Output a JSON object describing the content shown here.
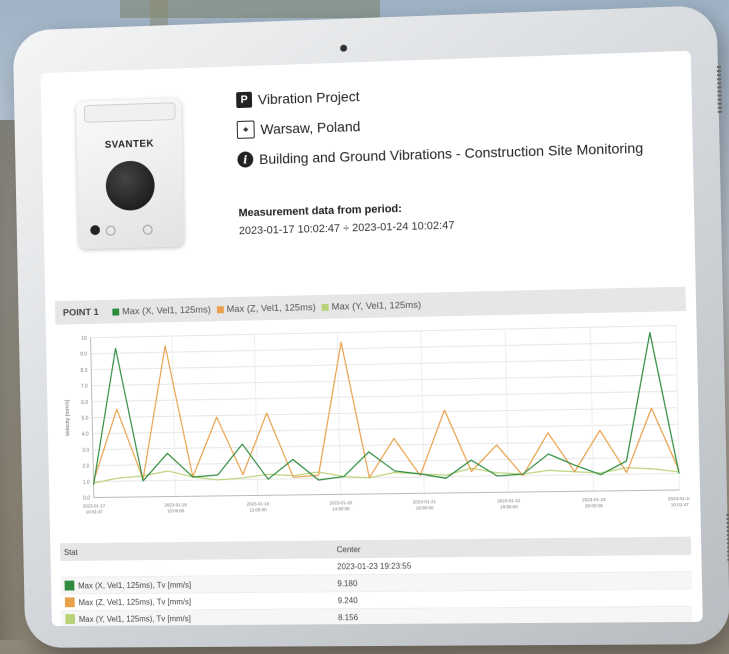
{
  "project": {
    "name": "Vibration Project",
    "location": "Warsaw, Poland",
    "description": "Building and Ground Vibrations - Construction Site Monitoring",
    "device_brand": "SVANTEK"
  },
  "period": {
    "label": "Measurement data from period:",
    "value": "2023-01-17 10:02:47 ÷ 2023-01-24 10:02:47"
  },
  "legend": {
    "point": "POINT 1",
    "items": [
      {
        "label": "Max (X, Vel1, 125ms)",
        "color": "#2e8b3e"
      },
      {
        "label": "Max (Z, Vel1, 125ms)",
        "color": "#e8a04a"
      },
      {
        "label": "Max (Y, Vel1, 125ms)",
        "color": "#b9d37a"
      }
    ]
  },
  "chart_data": {
    "type": "line",
    "ylabel": "Velocity [mm/s]",
    "ylim": [
      0,
      10
    ],
    "yticks": [
      "0.0",
      "1.0",
      "2.0",
      "3.0",
      "4.0",
      "5.0",
      "6.0",
      "7.0",
      "8.0",
      "9.0",
      "10"
    ],
    "x": [
      "2023-01-17 10:02:47",
      "2023-01-18 10:00:00",
      "2023-01-19 12:00:00",
      "2023-01-20 14:00:00",
      "2023-01-21 16:00:00",
      "2023-01-22 18:00:00",
      "2023-01-23 20:00:00",
      "2023-01-24 10:02:47"
    ],
    "xticks": [
      "2023-01-17\n10:02:47",
      "2023-01-18\n10:00:00",
      "2023-01-19\n12:00:00",
      "2023-01-20\n14:00:00",
      "2023-01-21\n16:00:00",
      "2023-01-22\n18:00:00",
      "2023-01-23\n20:00:00",
      "2023-01-24\n10:02:47"
    ],
    "series": [
      {
        "name": "Max (X, Vel1, 125ms)",
        "color": "#2e8b3e",
        "values": [
          0.8,
          9.3,
          1.0,
          2.7,
          1.2,
          1.3,
          3.2,
          1.0,
          2.2,
          0.9,
          1.1,
          2.6,
          1.4,
          1.2,
          0.9,
          2.0,
          1.0,
          1.1,
          2.3,
          1.6,
          1.0,
          1.8,
          9.6,
          1.0
        ]
      },
      {
        "name": "Max (Z, Vel1, 125ms)",
        "color": "#e8a04a",
        "values": [
          1.0,
          5.5,
          1.1,
          9.4,
          1.2,
          4.9,
          1.3,
          5.1,
          1.1,
          1.2,
          9.4,
          1.0,
          3.4,
          1.1,
          5.1,
          1.3,
          2.9,
          1.0,
          3.6,
          1.2,
          3.7,
          1.1,
          5.0,
          1.2
        ]
      },
      {
        "name": "Max (Y, Vel1, 125ms)",
        "color": "#b9d37a",
        "values": [
          0.9,
          1.2,
          1.3,
          1.6,
          1.2,
          1.0,
          1.1,
          1.3,
          1.2,
          1.4,
          1.1,
          1.0,
          1.3,
          1.2,
          1.1,
          1.5,
          1.2,
          1.1,
          1.3,
          1.2,
          1.1,
          1.4,
          1.3,
          1.1
        ]
      }
    ]
  },
  "table": {
    "header_col1": "Stat",
    "header_col2": "Center",
    "rows": [
      {
        "label": "",
        "value": "2023-01-23 19:23:55",
        "color": ""
      },
      {
        "label": "Max (X, Vel1, 125ms), Tv [mm/s]",
        "value": "9.180",
        "color": "#2e8b3e"
      },
      {
        "label": "Max (Z, Vel1, 125ms), Tv [mm/s]",
        "value": "9.240",
        "color": "#e8a04a"
      },
      {
        "label": "Max (Y, Vel1, 125ms), Tv [mm/s]",
        "value": "8.156",
        "color": "#b9d37a"
      }
    ]
  }
}
